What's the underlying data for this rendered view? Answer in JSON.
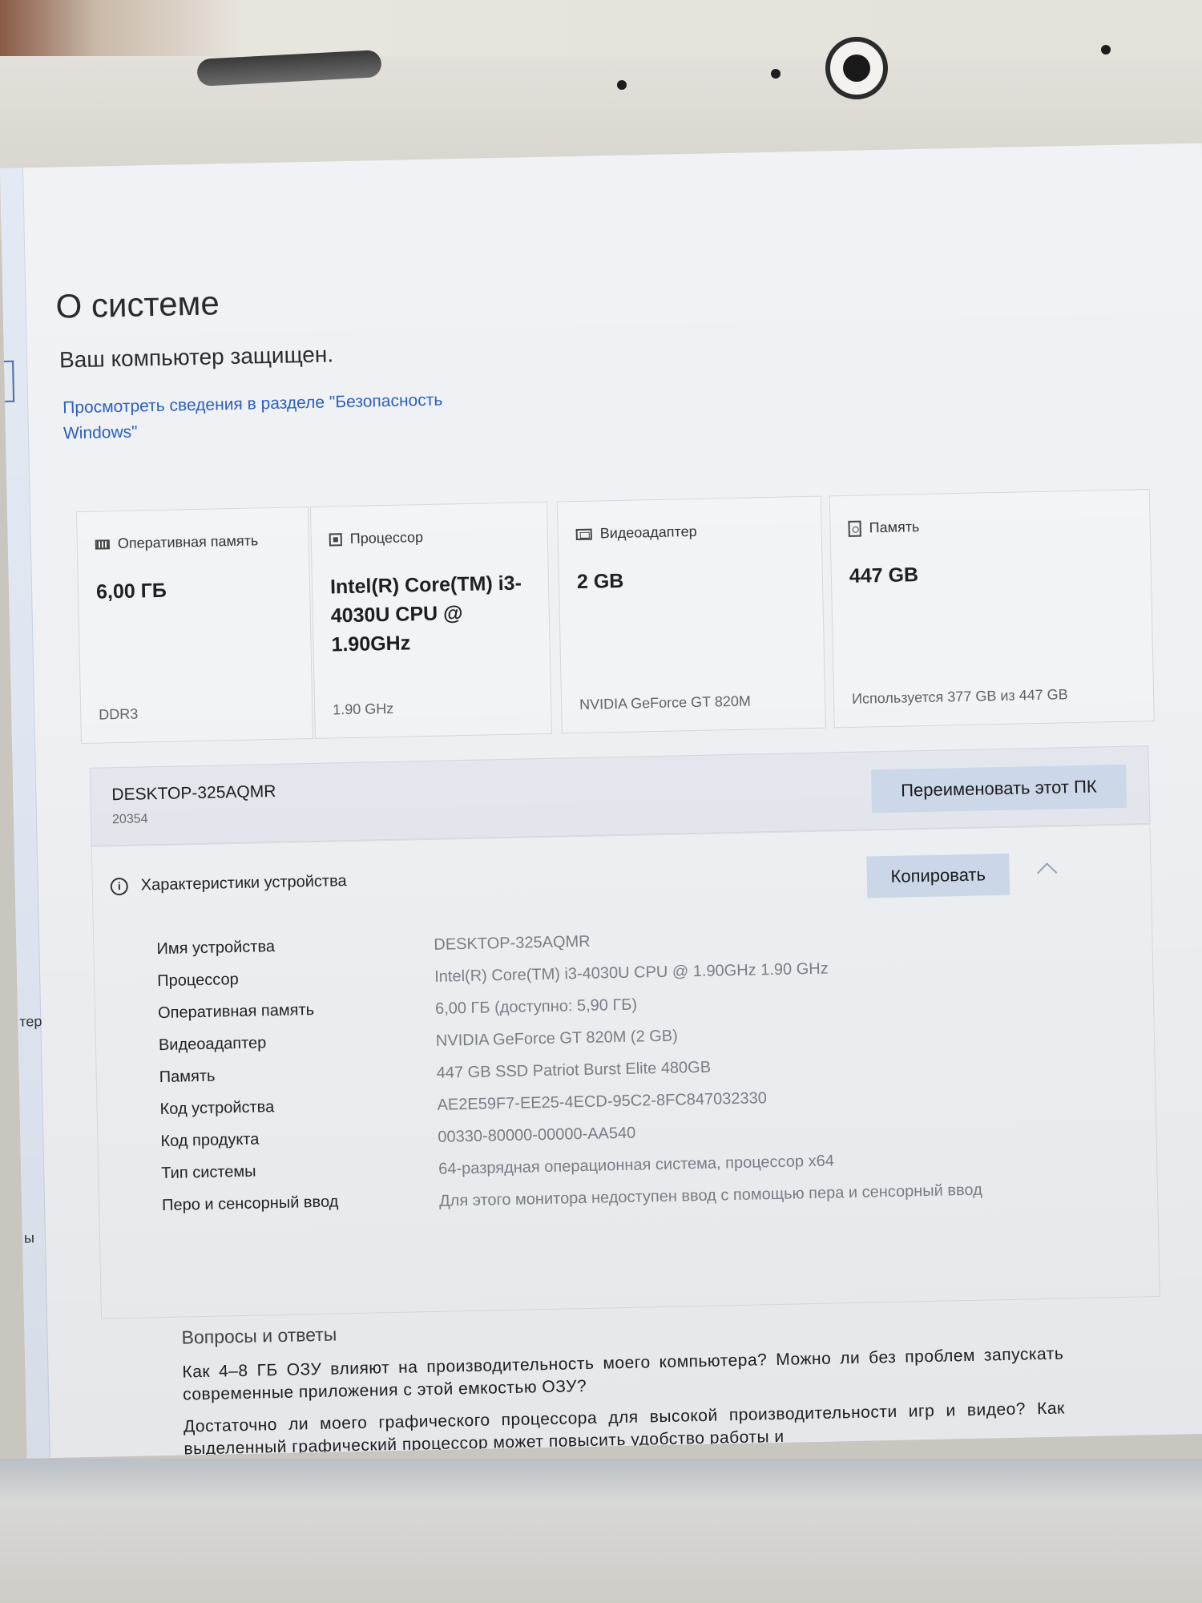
{
  "page": {
    "title": "О системе",
    "protection_status": "Ваш компьютер защищен.",
    "security_link": "Просмотреть сведения в разделе \"Безопасность Windows\""
  },
  "sidebar": {
    "fragment_1": "тер",
    "fragment_2": "ы"
  },
  "cards": {
    "ram": {
      "label": "Оперативная память",
      "value": "6,00 ГБ",
      "footer": "DDR3",
      "icon": "memory-icon"
    },
    "cpu": {
      "label": "Процессор",
      "value": "Intel(R) Core(TM) i3-4030U CPU @ 1.90GHz",
      "footer": "1.90 GHz",
      "icon": "processor-icon"
    },
    "gpu": {
      "label": "Видеоадаптер",
      "value": "2 GB",
      "footer": "NVIDIA GeForce GT 820M",
      "icon": "display-adapter-icon"
    },
    "storage": {
      "label": "Память",
      "value": "447 GB",
      "footer": "Используется 377 GB из 447 GB",
      "icon": "storage-icon"
    }
  },
  "pc": {
    "name": "DESKTOP-325AQMR",
    "build": "20354",
    "rename_button": "Переименовать этот ПК"
  },
  "specs": {
    "header": "Характеристики устройства",
    "copy_button": "Копировать",
    "rows": [
      {
        "key": "Имя устройства",
        "value": "DESKTOP-325AQMR"
      },
      {
        "key": "Процессор",
        "value": "Intel(R) Core(TM) i3-4030U CPU @ 1.90GHz   1.90 GHz"
      },
      {
        "key": "Оперативная память",
        "value": "6,00 ГБ (доступно: 5,90 ГБ)"
      },
      {
        "key": "Видеоадаптер",
        "value": "NVIDIA GeForce GT 820M (2 GB)"
      },
      {
        "key": "Память",
        "value": "447 GB SSD Patriot Burst Elite 480GB"
      },
      {
        "key": "Код устройства",
        "value": "AE2E59F7-EE25-4ECD-95C2-8FC847032330"
      },
      {
        "key": "Код продукта",
        "value": "00330-80000-00000-AA540"
      },
      {
        "key": "Тип системы",
        "value": "64-разрядная операционная система, процессор x64"
      },
      {
        "key": "Перо и сенсорный ввод",
        "value": "Для этого монитора недоступен ввод с помощью пера и сенсорный ввод"
      }
    ]
  },
  "qa": {
    "heading": "Вопросы и ответы",
    "q1": "Как 4–8 ГБ ОЗУ влияют на производительность моего компьютера? Можно ли без проблем запускать современные приложения с этой емкостью ОЗУ?",
    "q2": "Достаточно ли моего графического процессора для высокой производительности игр и видео? Как выделенный графический процессор может повысить удобство работы и"
  },
  "colors": {
    "accent_link": "#1b52b8",
    "button_bg": "#cdd9ea",
    "card_bg": "#f1f3f6",
    "page_bg": "#eef0f3"
  }
}
